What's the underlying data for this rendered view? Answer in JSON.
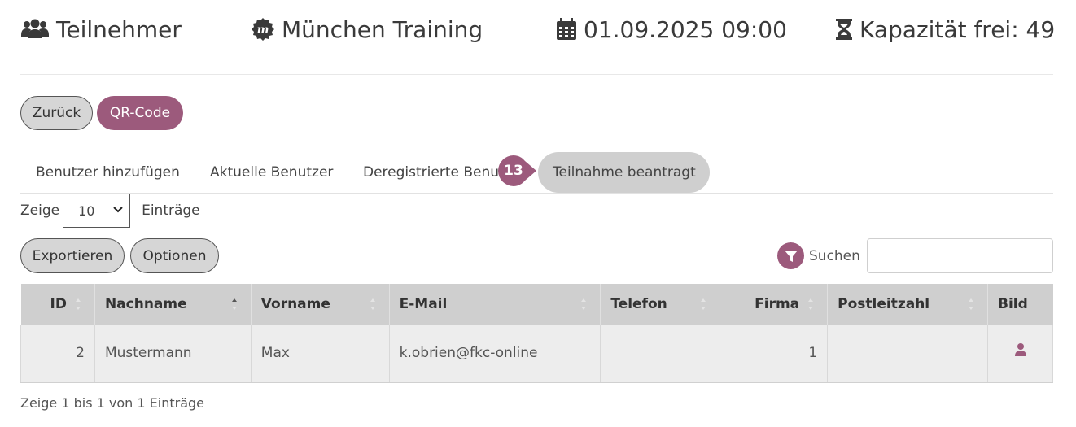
{
  "header": {
    "participants": "Teilnehmer",
    "event_name": "München Training",
    "datetime": "01.09.2025 09:00",
    "capacity": "Kapazität frei: 49"
  },
  "actions": {
    "back": "Zurück",
    "qr": "QR-Code"
  },
  "tabs": [
    {
      "label": "Benutzer hinzufügen"
    },
    {
      "label": "Aktuelle Benutzer"
    },
    {
      "label": "Deregistrierte Benut"
    },
    {
      "label": "Teilnahme beantragt",
      "active": true
    }
  ],
  "step_badge": "13",
  "length": {
    "prefix": "Zeige",
    "value": "10",
    "suffix": "Einträge"
  },
  "buttons": {
    "export": "Exportieren",
    "options": "Optionen"
  },
  "search": {
    "label": "Suchen",
    "value": ""
  },
  "table": {
    "columns": [
      "ID",
      "Nachname",
      "Vorname",
      "E-Mail",
      "Telefon",
      "Firma",
      "Postleitzahl",
      "Bild"
    ],
    "rows": [
      {
        "id": "2",
        "lastname": "Mustermann",
        "firstname": "Max",
        "email": "k.obrien@fkc-online",
        "phone": "",
        "company": "1",
        "zip": "",
        "image": "person-icon"
      }
    ]
  },
  "footer_info": "Zeige 1 bis 1 von 1 Einträge",
  "colors": {
    "brand": "#9c5a7c",
    "pill_grey": "#d6d6d6",
    "header_bg": "#cfcfcf"
  }
}
